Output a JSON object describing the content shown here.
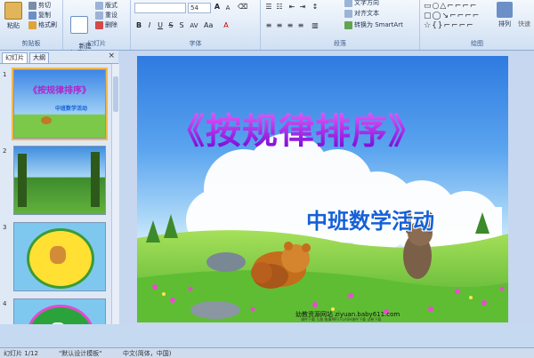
{
  "ribbon": {
    "clipboard": {
      "group_label": "剪贴板",
      "paste_label": "粘贴",
      "cut_label": "剪切",
      "copy_label": "复制",
      "format_painter_label": "格式刷"
    },
    "slides": {
      "group_label": "幻灯片",
      "new_slide_label": "新建\n幻灯片",
      "layout_label": "版式",
      "reset_label": "重设",
      "delete_label": "删除"
    },
    "font": {
      "group_label": "字体",
      "font_size": "54"
    },
    "paragraph": {
      "group_label": "段落",
      "text_direction_label": "文字方向",
      "align_text_label": "对齐文本",
      "convert_smartart_label": "转换为 SmartArt"
    },
    "drawing": {
      "group_label": "绘图",
      "arrange_label": "排列",
      "quick_styles_label": "快速"
    }
  },
  "panel": {
    "tab_slides": "幻灯片",
    "tab_outline": "大纲",
    "close_glyph": "×"
  },
  "thumbnails": [
    {
      "number": "1",
      "title": "《按规律排序》",
      "subtitle": "中班数学活动"
    },
    {
      "number": "2"
    },
    {
      "number": "3"
    },
    {
      "number": "4"
    }
  ],
  "slide": {
    "title": "《按规律排序》",
    "subtitle": "中班数学活动",
    "footer_site": "幼教资源网站 ziyuan.baby611.com",
    "footer_small": "课件下载 儿歌 故事MP3 FLASH课件下载 试卷下载"
  },
  "statusbar": {
    "slide_count": "幻灯片 1/12",
    "theme": "\"默认设计模板\"",
    "language": "中文(简体，中国)"
  },
  "colors": {
    "title_gradient_top": "#ff66ff",
    "title_gradient_bottom": "#6a00d4",
    "subtitle": "#1560d8",
    "sky": "#2e7ae0",
    "grass": "#6cc43a"
  }
}
